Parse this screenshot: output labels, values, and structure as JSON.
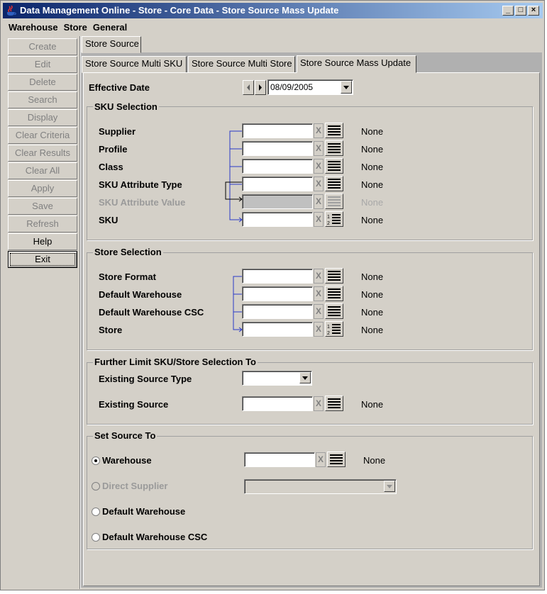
{
  "window": {
    "title": "Data Management Online - Store - Core Data - Store Source Mass Update"
  },
  "menu": [
    "Warehouse",
    "Store",
    "General"
  ],
  "sidebar": {
    "buttons": [
      {
        "label": "Create",
        "enabled": false
      },
      {
        "label": "Edit",
        "enabled": false
      },
      {
        "label": "Delete",
        "enabled": false
      },
      {
        "label": "Search",
        "enabled": false
      },
      {
        "label": "Display",
        "enabled": false
      },
      {
        "label": "Clear Criteria",
        "enabled": false
      },
      {
        "label": "Clear Results",
        "enabled": false
      },
      {
        "label": "Clear All",
        "enabled": false
      },
      {
        "label": "Apply",
        "enabled": false
      },
      {
        "label": "Save",
        "enabled": false
      },
      {
        "label": "Refresh",
        "enabled": false
      },
      {
        "label": "Help",
        "enabled": true
      },
      {
        "label": "Exit",
        "enabled": true
      }
    ]
  },
  "tabs": {
    "top": "Store Source",
    "sub": [
      "Store Source Multi SKU",
      "Store Source Multi Store",
      "Store Source Mass Update"
    ],
    "active_sub": "Store Source Mass Update"
  },
  "effective_date": {
    "label": "Effective Date",
    "value": "08/09/2005"
  },
  "sku_selection": {
    "title": "SKU Selection",
    "rows": [
      {
        "label": "Supplier",
        "value": "",
        "result": "None",
        "enabled": true
      },
      {
        "label": "Profile",
        "value": "",
        "result": "None",
        "enabled": true
      },
      {
        "label": "Class",
        "value": "",
        "result": "None",
        "enabled": true
      },
      {
        "label": "SKU Attribute Type",
        "value": "",
        "result": "None",
        "enabled": true
      },
      {
        "label": "SKU Attribute Value",
        "value": "",
        "result": "None",
        "enabled": false
      },
      {
        "label": "SKU",
        "value": "",
        "result": "None",
        "enabled": true
      }
    ]
  },
  "store_selection": {
    "title": "Store Selection",
    "rows": [
      {
        "label": "Store Format",
        "value": "",
        "result": "None"
      },
      {
        "label": "Default Warehouse",
        "value": "",
        "result": "None"
      },
      {
        "label": "Default Warehouse CSC",
        "value": "",
        "result": "None"
      },
      {
        "label": "Store",
        "value": "",
        "result": "None"
      }
    ]
  },
  "further_limit": {
    "title": "Further Limit SKU/Store Selection To",
    "existing_source_type": {
      "label": "Existing Source Type",
      "value": ""
    },
    "existing_source": {
      "label": "Existing Source",
      "value": "",
      "result": "None"
    }
  },
  "set_source": {
    "title": "Set Source To",
    "options": [
      {
        "label": "Warehouse",
        "selected": true,
        "enabled": true
      },
      {
        "label": "Direct Supplier",
        "selected": false,
        "enabled": false
      },
      {
        "label": "Default Warehouse",
        "selected": false,
        "enabled": true
      },
      {
        "label": "Default Warehouse CSC",
        "selected": false,
        "enabled": true
      }
    ],
    "warehouse_value": "",
    "warehouse_result": "None",
    "direct_supplier_value": ""
  },
  "icons": {
    "x_button": "clear-icon",
    "list_button": "list-lookup-icon",
    "numbered_list_button": "numbered-list-icon",
    "app": "java-cup-icon"
  }
}
